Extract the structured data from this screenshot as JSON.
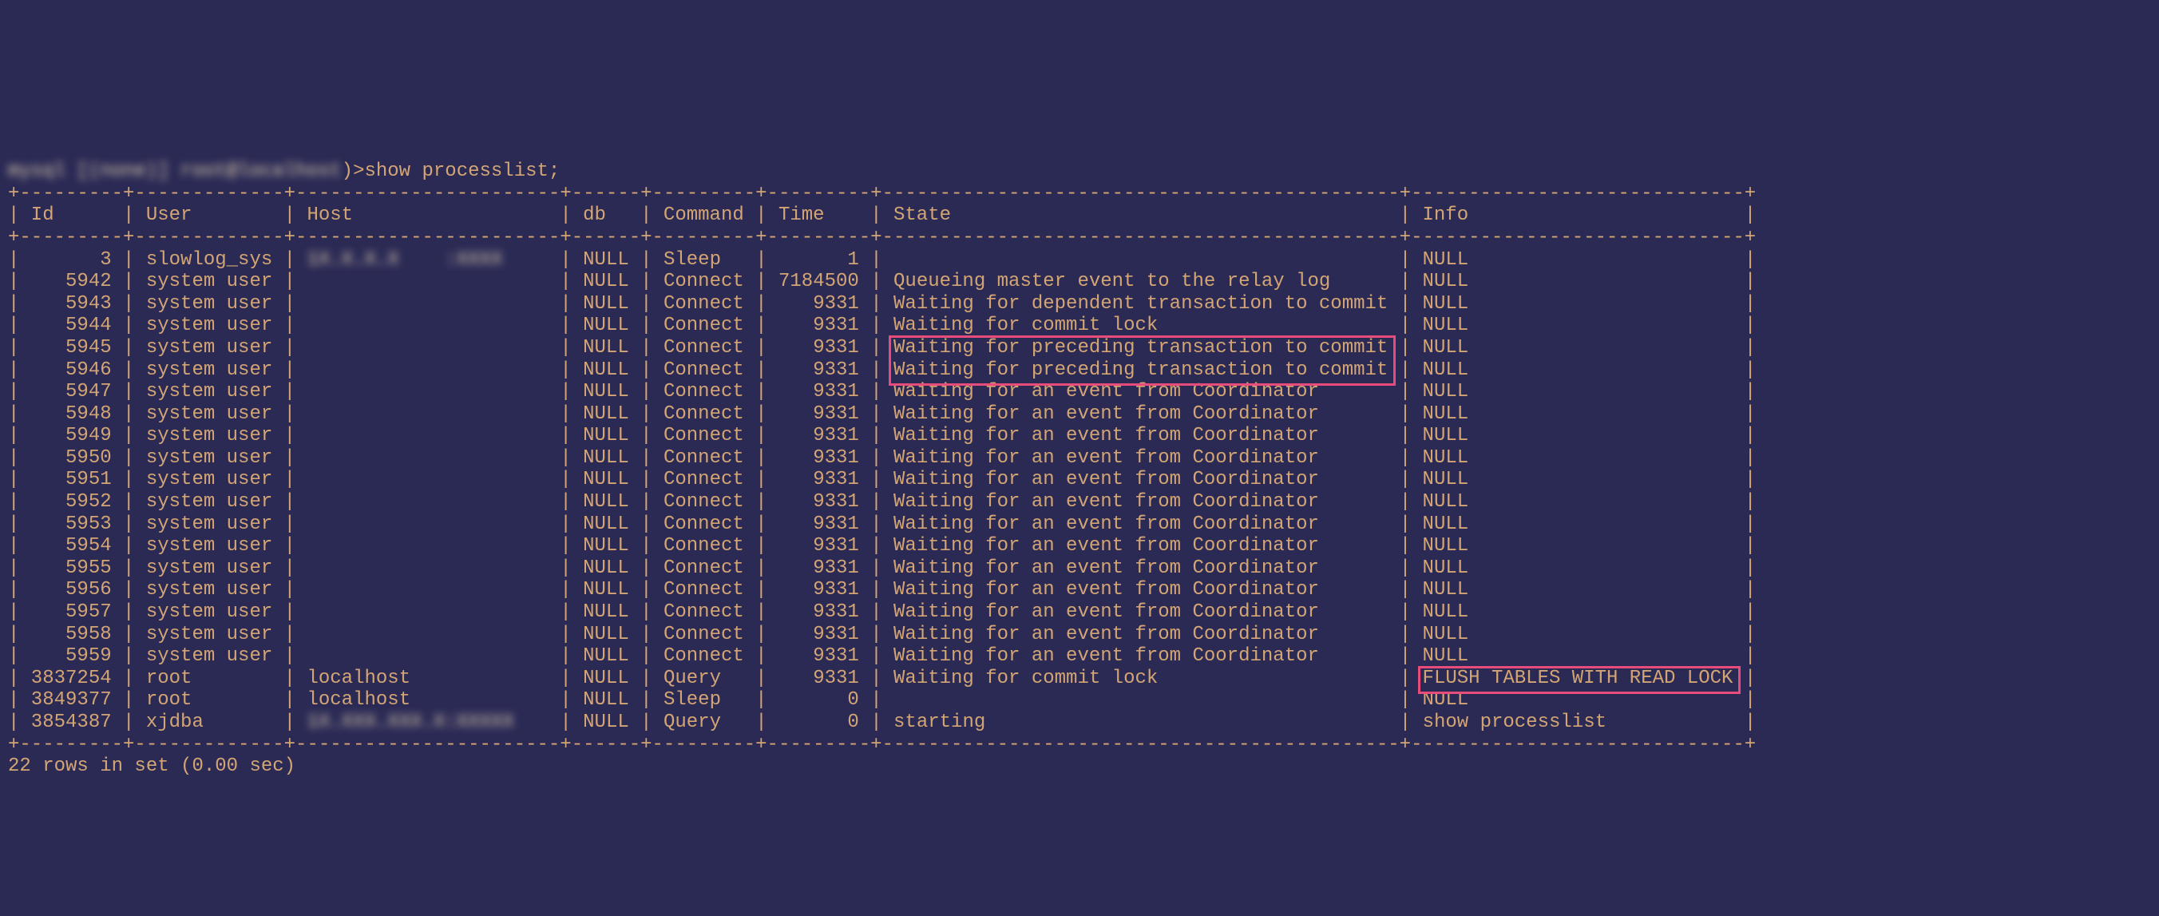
{
  "prompt_prefix_blur": "mysql [(none)] root@localhost",
  "prompt_suffix": ")>show processlist;",
  "divider_top": "+---------+-------------+-----------------------+------+---------+---------+---------------------------------------------+-----------------------------+",
  "header": "| Id      | User        | Host                  | db   | Command | Time    | State                                       | Info                        |",
  "divider_mid": "+---------+-------------+-----------------------+------+---------+---------+---------------------------------------------+-----------------------------+",
  "rows": [
    {
      "id": "3",
      "user": "slowlog_sys",
      "host_blur": "1X.X.X.X    :XXXX",
      "db": "NULL",
      "command": "Sleep",
      "time": "1",
      "state": "",
      "info": "NULL"
    },
    {
      "id": "5942",
      "user": "system user",
      "host_blur": "",
      "db": "NULL",
      "command": "Connect",
      "time": "7184500",
      "state": "Queueing master event to the relay log",
      "info": "NULL"
    },
    {
      "id": "5943",
      "user": "system user",
      "host_blur": "",
      "db": "NULL",
      "command": "Connect",
      "time": "9331",
      "state": "Waiting for dependent transaction to commit",
      "info": "NULL"
    },
    {
      "id": "5944",
      "user": "system user",
      "host_blur": "",
      "db": "NULL",
      "command": "Connect",
      "time": "9331",
      "state": "Waiting for commit lock",
      "info": "NULL"
    },
    {
      "id": "5945",
      "user": "system user",
      "host_blur": "",
      "db": "NULL",
      "command": "Connect",
      "time": "9331",
      "state": "Waiting for preceding transaction to commit",
      "info": "NULL"
    },
    {
      "id": "5946",
      "user": "system user",
      "host_blur": "",
      "db": "NULL",
      "command": "Connect",
      "time": "9331",
      "state": "Waiting for preceding transaction to commit",
      "info": "NULL"
    },
    {
      "id": "5947",
      "user": "system user",
      "host_blur": "",
      "db": "NULL",
      "command": "Connect",
      "time": "9331",
      "state": "Waiting for an event from Coordinator",
      "info": "NULL"
    },
    {
      "id": "5948",
      "user": "system user",
      "host_blur": "",
      "db": "NULL",
      "command": "Connect",
      "time": "9331",
      "state": "Waiting for an event from Coordinator",
      "info": "NULL"
    },
    {
      "id": "5949",
      "user": "system user",
      "host_blur": "",
      "db": "NULL",
      "command": "Connect",
      "time": "9331",
      "state": "Waiting for an event from Coordinator",
      "info": "NULL"
    },
    {
      "id": "5950",
      "user": "system user",
      "host_blur": "",
      "db": "NULL",
      "command": "Connect",
      "time": "9331",
      "state": "Waiting for an event from Coordinator",
      "info": "NULL"
    },
    {
      "id": "5951",
      "user": "system user",
      "host_blur": "",
      "db": "NULL",
      "command": "Connect",
      "time": "9331",
      "state": "Waiting for an event from Coordinator",
      "info": "NULL"
    },
    {
      "id": "5952",
      "user": "system user",
      "host_blur": "",
      "db": "NULL",
      "command": "Connect",
      "time": "9331",
      "state": "Waiting for an event from Coordinator",
      "info": "NULL"
    },
    {
      "id": "5953",
      "user": "system user",
      "host_blur": "",
      "db": "NULL",
      "command": "Connect",
      "time": "9331",
      "state": "Waiting for an event from Coordinator",
      "info": "NULL"
    },
    {
      "id": "5954",
      "user": "system user",
      "host_blur": "",
      "db": "NULL",
      "command": "Connect",
      "time": "9331",
      "state": "Waiting for an event from Coordinator",
      "info": "NULL"
    },
    {
      "id": "5955",
      "user": "system user",
      "host_blur": "",
      "db": "NULL",
      "command": "Connect",
      "time": "9331",
      "state": "Waiting for an event from Coordinator",
      "info": "NULL"
    },
    {
      "id": "5956",
      "user": "system user",
      "host_blur": "",
      "db": "NULL",
      "command": "Connect",
      "time": "9331",
      "state": "Waiting for an event from Coordinator",
      "info": "NULL"
    },
    {
      "id": "5957",
      "user": "system user",
      "host_blur": "",
      "db": "NULL",
      "command": "Connect",
      "time": "9331",
      "state": "Waiting for an event from Coordinator",
      "info": "NULL"
    },
    {
      "id": "5958",
      "user": "system user",
      "host_blur": "",
      "db": "NULL",
      "command": "Connect",
      "time": "9331",
      "state": "Waiting for an event from Coordinator",
      "info": "NULL"
    },
    {
      "id": "5959",
      "user": "system user",
      "host_blur": "",
      "db": "NULL",
      "command": "Connect",
      "time": "9331",
      "state": "Waiting for an event from Coordinator",
      "info": "NULL"
    },
    {
      "id": "3837254",
      "user": "root",
      "host_blur": "localhost",
      "db": "NULL",
      "command": "Query",
      "time": "9331",
      "state": "Waiting for commit lock",
      "info": "FLUSH TABLES WITH READ LOCK"
    },
    {
      "id": "3849377",
      "user": "root",
      "host_blur": "localhost",
      "db": "NULL",
      "command": "Sleep",
      "time": "0",
      "state": "",
      "info": "NULL"
    },
    {
      "id": "3854387",
      "user": "xjdba",
      "host_blur": "1X.XXX.XXX.X:XXXXX",
      "db": "NULL",
      "command": "Query",
      "time": "0",
      "state": "starting",
      "info": "show processlist"
    }
  ],
  "divider_bot": "+---------+-------------+-----------------------+------+---------+---------+---------------------------------------------+-----------------------------+",
  "footer": "22 rows in set (0.00 sec)",
  "col_widths": {
    "id": 7,
    "user": 11,
    "host": 21,
    "db": 4,
    "command": 7,
    "time": 7,
    "state": 43,
    "info": 27
  },
  "blur_host_rows": [
    0,
    21
  ],
  "highlight_state_rows": [
    4,
    5
  ],
  "highlight_info_rows": [
    19
  ]
}
